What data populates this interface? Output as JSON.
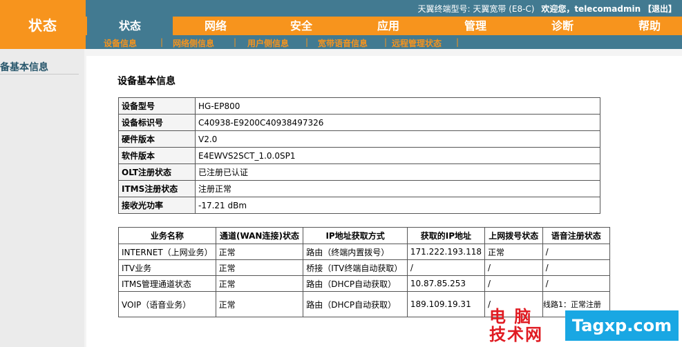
{
  "header": {
    "brand": "状态",
    "device_info": "天翼终端型号: 天翼宽带 (E8-C)",
    "welcome": "欢迎您，telecomadmin",
    "logout": "【退出】"
  },
  "mainnav": {
    "tabs": [
      {
        "label": "状态",
        "active": true
      },
      {
        "label": "网络",
        "active": false
      },
      {
        "label": "安全",
        "active": false
      },
      {
        "label": "应用",
        "active": false
      },
      {
        "label": "管理",
        "active": false
      },
      {
        "label": "诊断",
        "active": false
      },
      {
        "label": "帮助",
        "active": false
      }
    ]
  },
  "subnav": {
    "items": [
      "设备信息",
      "网络侧信息",
      "用户侧信息",
      "宽带语音信息",
      "远程管理状态"
    ],
    "separator": "|"
  },
  "sidebar": {
    "title": "备基本信息"
  },
  "main": {
    "section_title": "设备基本信息",
    "info_rows": [
      {
        "key": "设备型号",
        "value": "HG-EP800"
      },
      {
        "key": "设备标识号",
        "value": "C40938-E9200C40938497326"
      },
      {
        "key": "硬件版本",
        "value": "V2.0"
      },
      {
        "key": "软件版本",
        "value": "E4EWVS2SCT_1.0.0SP1"
      },
      {
        "key": "OLT注册状态",
        "value": "已注册已认证"
      },
      {
        "key": "ITMS注册状态",
        "value": "注册正常"
      },
      {
        "key": "接收光功率",
        "value": "-17.21 dBm"
      }
    ],
    "service_table": {
      "headers": [
        "业务名称",
        "通道(WAN连接)状态",
        "IP地址获取方式",
        "获取的IP地址",
        "上网拨号状态",
        "语音注册状态"
      ],
      "rows": [
        [
          "INTERNET（上网业务）",
          "正常",
          "路由（终端内置拨号）",
          "171.222.193.118",
          "正常",
          "/"
        ],
        [
          "ITV业务",
          "正常",
          "桥接（ITV终端自动获取）",
          "/",
          "/",
          "/"
        ],
        [
          "ITMS管理通道状态",
          "正常",
          "路由（DHCP自动获取）",
          "10.87.85.253",
          "/",
          "/"
        ],
        [
          "VOIP（语音业务）",
          "正常",
          "路由（DHCP自动获取）",
          "189.109.19.31",
          "/",
          ""
        ]
      ]
    },
    "voip_note": "线路1：正常注册"
  },
  "watermark": {
    "cn_line1": "电 脑",
    "cn_line2": "技术网",
    "domain": "Tagxp.com"
  },
  "colors": {
    "orange": "#f7941d",
    "teal": "#427a91"
  }
}
